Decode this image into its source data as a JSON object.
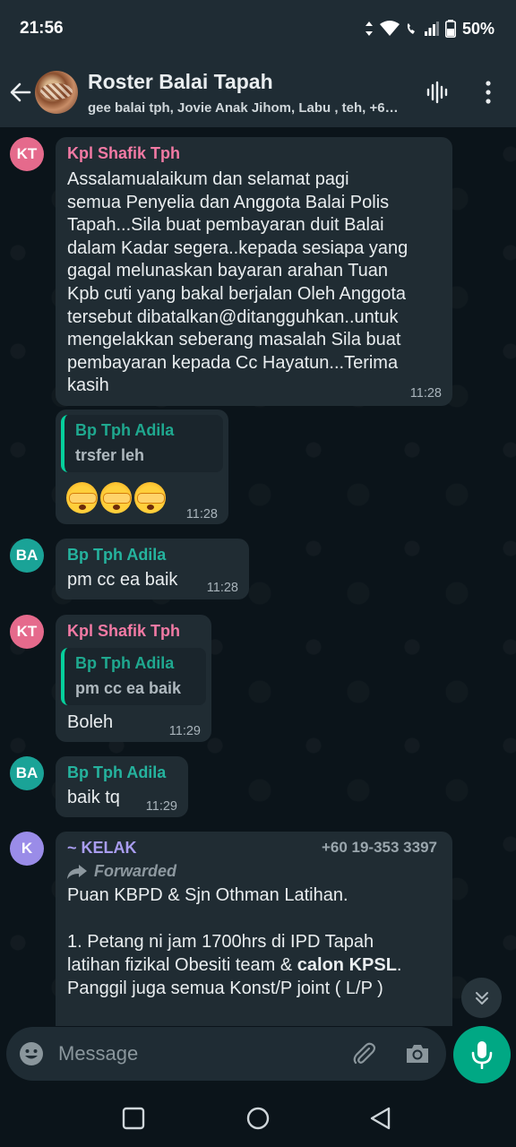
{
  "status": {
    "time": "21:56",
    "battery": "50%"
  },
  "header": {
    "title": "Roster Balai Tapah",
    "members": "gee balai tph, Jovie Anak Jihom, Labu , teh, +6…"
  },
  "messages": [
    {
      "avatar": "KT",
      "sender": "Kpl Shafik Tph",
      "text": "Assalamualaikum dan selamat pagi\nsemua Penyelia dan Anggota Balai Polis\nTapah...Sila buat pembayaran duit Balai\ndalam Kadar segera..kepada sesiapa yang\ngagal melunaskan bayaran arahan Tuan\nKpb cuti yang bakal berjalan Oleh Anggota\ntersebut dibatalkan@ditangguhkan..untuk\nmengelakkan seberang masalah Sila buat\npembayaran kepada Cc Hayatun...Terima\nkasih",
      "time": "11:28"
    },
    {
      "quote_sender": "Bp Tph Adila",
      "quote_text": "trsfer leh",
      "emoji_count": 3,
      "time": "11:28"
    },
    {
      "avatar": "BA",
      "sender": "Bp Tph Adila",
      "text": "pm cc ea baik",
      "time": "11:28"
    },
    {
      "avatar": "KT",
      "sender": "Kpl Shafik Tph",
      "quote_sender": "Bp Tph Adila",
      "quote_text": "pm cc ea baik",
      "text": "Boleh",
      "time": "11:29"
    },
    {
      "avatar": "BA",
      "sender": "Bp Tph Adila",
      "text": "baik tq",
      "time": "11:29"
    },
    {
      "avatar": "K",
      "sender": "~ KELAK",
      "phone": "+60 19-353 3397",
      "forwarded": "Forwarded",
      "line1": "Puan KBPD & Sjn Othman Latihan.",
      "line2": "1. Petang ni jam 1700hrs di IPD Tapah",
      "line3_pre": "latihan fizikal Obesiti team & ",
      "line3_bold": "calon KPSL",
      "line3_post": ".",
      "line4": "Panggil juga semua Konst/P joint ( L/P )"
    }
  ],
  "input": {
    "placeholder": "Message"
  },
  "colors": {
    "accent": "#00a884",
    "bubble": "#202c33",
    "background": "#0b141a",
    "header": "#1f2c34"
  },
  "icons": [
    "back-arrow-icon",
    "voice-chat-icon",
    "more-options-icon",
    "forward-icon",
    "scroll-down-icon",
    "emoji-icon",
    "attach-icon",
    "camera-icon",
    "mic-icon",
    "nav-recents-icon",
    "nav-home-icon",
    "nav-back-icon"
  ]
}
